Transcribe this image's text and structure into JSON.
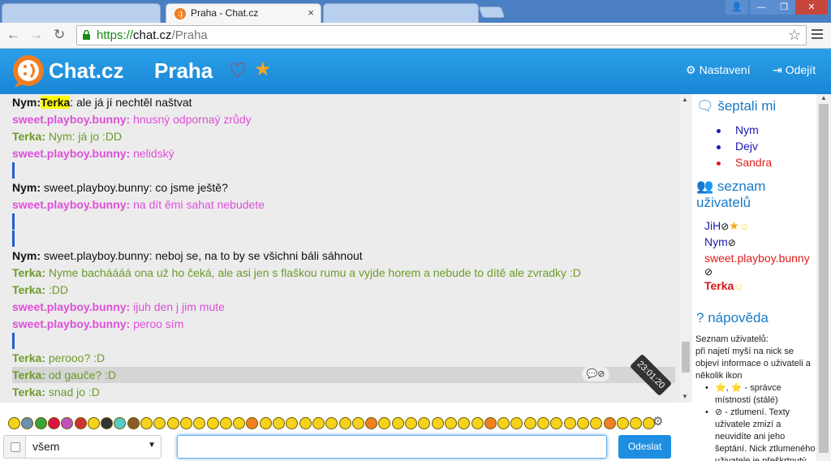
{
  "browser": {
    "tab_title": "Praha - Chat.cz",
    "tab_favicon": ":)",
    "tab_close": "×",
    "url_scheme": "https://",
    "url_host": "chat.cz",
    "url_path": "/Praha",
    "window_controls": [
      "👤",
      "—",
      "❐",
      "✕"
    ]
  },
  "header": {
    "brand": "Chat.cz",
    "room": "Praha",
    "settings_label": "Nastavení",
    "logout_label": "Odejít"
  },
  "chat": {
    "messages": [
      {
        "nick": "Nym:",
        "type": "nym",
        "mention": "Terka",
        "text": ": ale já jí nechtěl naštvat"
      },
      {
        "nick": "sweet.playboy.bunny:",
        "type": "sweet",
        "text": " hnusný odpornaý zrůdy"
      },
      {
        "nick": "Terka:",
        "type": "terka",
        "text": " Nym: já jo :DD"
      },
      {
        "nick": "sweet.playboy.bunny:",
        "type": "sweet",
        "text": " nelidský"
      },
      {
        "nick": "Nym:",
        "type": "nym",
        "text": " sweet.playboy.bunny: co jsme ještě?"
      },
      {
        "nick": "sweet.playboy.bunny:",
        "type": "sweet",
        "text": " na dít ěmi sahat nebudete"
      },
      {
        "nick": "Nym:",
        "type": "nym",
        "text": " sweet.playboy.bunny: neboj se, na to by se všichni báli sáhnout"
      },
      {
        "nick": "Terka:",
        "type": "terka",
        "text": " Nyme bacháááá ona už ho čeká, ale asi jen s flaškou rumu a vyjde horem a nebude to dítě ale zvradky :D"
      },
      {
        "nick": "Terka:",
        "type": "terka",
        "text": " :DD"
      },
      {
        "nick": "sweet.playboy.bunny:",
        "type": "sweet",
        "text": " ijuh den j jim mute"
      },
      {
        "nick": "sweet.playboy.bunny:",
        "type": "sweet",
        "text": " peroo sím"
      },
      {
        "nick": "Terka:",
        "type": "terka",
        "text": " perooo? :D"
      },
      {
        "nick": "Terka:",
        "type": "terka",
        "text": " od gauče? :D"
      },
      {
        "nick": "Terka:",
        "type": "terka",
        "text": " snad jo :D"
      }
    ],
    "timestamp": "23:01:20",
    "msg_actions": "💬⊘"
  },
  "sidebar": {
    "whisper_title": "šeptali mi",
    "whispers": [
      {
        "name": "Nym",
        "color": "#1a1ab0"
      },
      {
        "name": "Dejv",
        "color": "#1a1ab0"
      },
      {
        "name": "Sandra",
        "color": "#e01b1b"
      }
    ],
    "users_title_1": "seznam",
    "users_title_2": "uživatelů",
    "users": [
      {
        "name": "JiH",
        "color": "#1a1ab0",
        "ban": "⊘",
        "star": "★",
        "sun": "☼"
      },
      {
        "name": "Nym",
        "color": "#1a1ab0",
        "ban": "⊘"
      },
      {
        "name": "sweet.playboy.bunny",
        "color": "#e01b1b",
        "ban": "⊘"
      },
      {
        "name": "Terka",
        "color": "#d11717",
        "sun": "☼"
      }
    ],
    "help_title": "nápověda",
    "help_intro": [
      "Seznam uživatelů:",
      "při najetí myší na nick se",
      "objeví informace o uživateli a",
      "několik ikon"
    ],
    "help_items": [
      "⭐, ⭐ - správce místnosti (stálé)",
      "⊘ - ztlumení. Texty uživatele zmizí a neuvidíte ani jeho šeptání. Nick ztlumeného uživatele je přeškrtnutý"
    ]
  },
  "input": {
    "target_select": "všem",
    "send_label": "Odeslat"
  },
  "colors": {
    "header_blue": "#1a86d6",
    "nym": "#111111",
    "terka": "#6d9b2a",
    "sweet": "#de4fd9"
  }
}
